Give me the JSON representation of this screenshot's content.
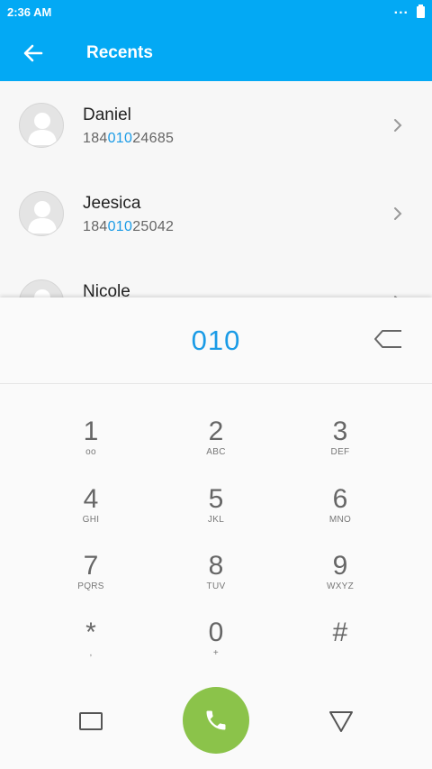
{
  "status_bar": {
    "time": "2:36 AM",
    "overflow": "..."
  },
  "app_bar": {
    "title": "Recents",
    "back_icon": "arrow-left-icon"
  },
  "recents": [
    {
      "name": "Daniel",
      "number_prefix": "184",
      "number_match": "010",
      "number_suffix": "24685"
    },
    {
      "name": "Jeesica",
      "number_prefix": "184",
      "number_match": "010",
      "number_suffix": "25042"
    },
    {
      "name": "Nicole",
      "number_prefix": "",
      "number_match": "",
      "number_suffix": ""
    }
  ],
  "dialer": {
    "input": "010",
    "keys": [
      {
        "digit": "1",
        "letters": "oo"
      },
      {
        "digit": "2",
        "letters": "ABC"
      },
      {
        "digit": "3",
        "letters": "DEF"
      },
      {
        "digit": "4",
        "letters": "GHI"
      },
      {
        "digit": "5",
        "letters": "JKL"
      },
      {
        "digit": "6",
        "letters": "MNO"
      },
      {
        "digit": "7",
        "letters": "PQRS"
      },
      {
        "digit": "8",
        "letters": "TUV"
      },
      {
        "digit": "9",
        "letters": "WXYZ"
      },
      {
        "digit": "*",
        "letters": ","
      },
      {
        "digit": "0",
        "letters": "+"
      },
      {
        "digit": "#",
        "letters": ""
      }
    ]
  },
  "colors": {
    "primary": "#03a9f4",
    "highlight": "#1a9be6",
    "call_button": "#8bc34a"
  }
}
